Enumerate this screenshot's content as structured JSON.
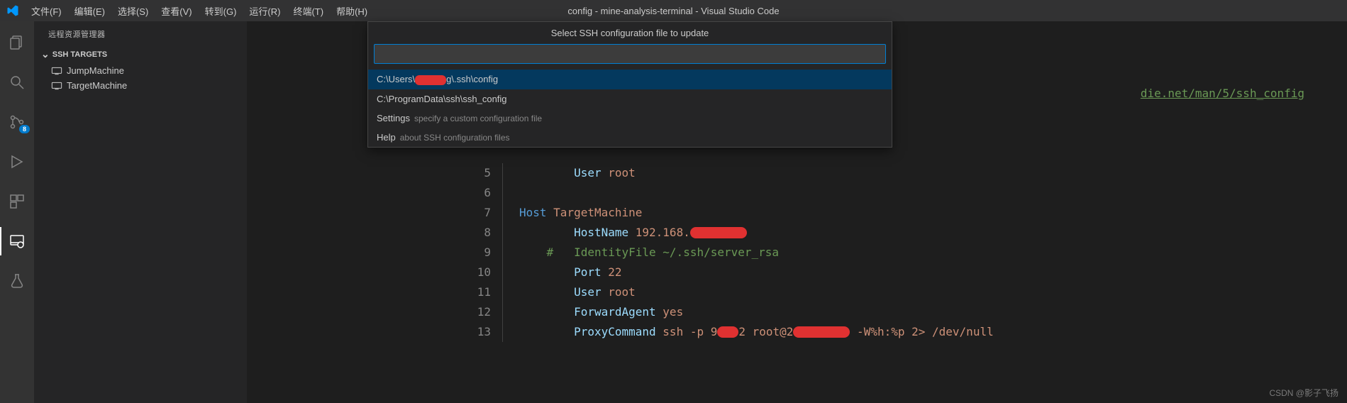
{
  "title": "config - mine-analysis-terminal - Visual Studio Code",
  "menu": [
    "文件(F)",
    "编辑(E)",
    "选择(S)",
    "查看(V)",
    "转到(G)",
    "运行(R)",
    "终端(T)",
    "帮助(H)"
  ],
  "sidebar": {
    "title": "远程资源管理器",
    "section": "SSH TARGETS",
    "targets": [
      "JumpMachine",
      "TargetMachine"
    ]
  },
  "badge": "8",
  "watermark": "CSDN @影子飞扬",
  "header_link": "die.net/man/5/ssh_config",
  "quickpick": {
    "title": "Select SSH configuration file to update",
    "items": [
      {
        "prefix": "C:\\Users\\",
        "suffix": "g\\.ssh\\config",
        "redacted": true
      },
      {
        "label": "C:\\ProgramData\\ssh\\ssh_config"
      },
      {
        "label": "Settings",
        "detail": "specify a custom configuration file"
      },
      {
        "label": "Help",
        "detail": "about SSH configuration files"
      }
    ]
  },
  "code": {
    "lines": [
      {
        "n": 5,
        "indent": 2,
        "tokens": [
          {
            "t": "User ",
            "c": "k-teal"
          },
          {
            "t": "root",
            "c": "k-orange"
          }
        ]
      },
      {
        "n": 6,
        "indent": 0,
        "tokens": []
      },
      {
        "n": 7,
        "indent": 0,
        "tokens": [
          {
            "t": "Host ",
            "c": "k-blue"
          },
          {
            "t": "TargetMachine",
            "c": "k-orange"
          }
        ]
      },
      {
        "n": 8,
        "indent": 2,
        "tokens": [
          {
            "t": "HostName ",
            "c": "k-teal"
          },
          {
            "t": "192.168.",
            "c": "k-orange"
          },
          {
            "redact": 80
          }
        ]
      },
      {
        "n": 9,
        "indent": 1,
        "tokens": [
          {
            "t": "#   IdentityFile ~/.ssh/server_rsa",
            "c": "k-green"
          }
        ]
      },
      {
        "n": 10,
        "indent": 2,
        "tokens": [
          {
            "t": "Port ",
            "c": "k-teal"
          },
          {
            "t": "22",
            "c": "k-orange"
          }
        ]
      },
      {
        "n": 11,
        "indent": 2,
        "tokens": [
          {
            "t": "User ",
            "c": "k-teal"
          },
          {
            "t": "root",
            "c": "k-orange"
          }
        ]
      },
      {
        "n": 12,
        "indent": 2,
        "tokens": [
          {
            "t": "ForwardAgent ",
            "c": "k-teal"
          },
          {
            "t": "yes",
            "c": "k-orange"
          }
        ]
      },
      {
        "n": 13,
        "indent": 2,
        "tokens": [
          {
            "t": "ProxyCommand ",
            "c": "k-teal"
          },
          {
            "t": "ssh -p 9",
            "c": "k-orange"
          },
          {
            "redact": 30
          },
          {
            "t": "2 root@2",
            "c": "k-orange"
          },
          {
            "redact": 80
          },
          {
            "t": " -W%h:%p 2> /dev/null",
            "c": "k-orange"
          }
        ]
      }
    ]
  }
}
